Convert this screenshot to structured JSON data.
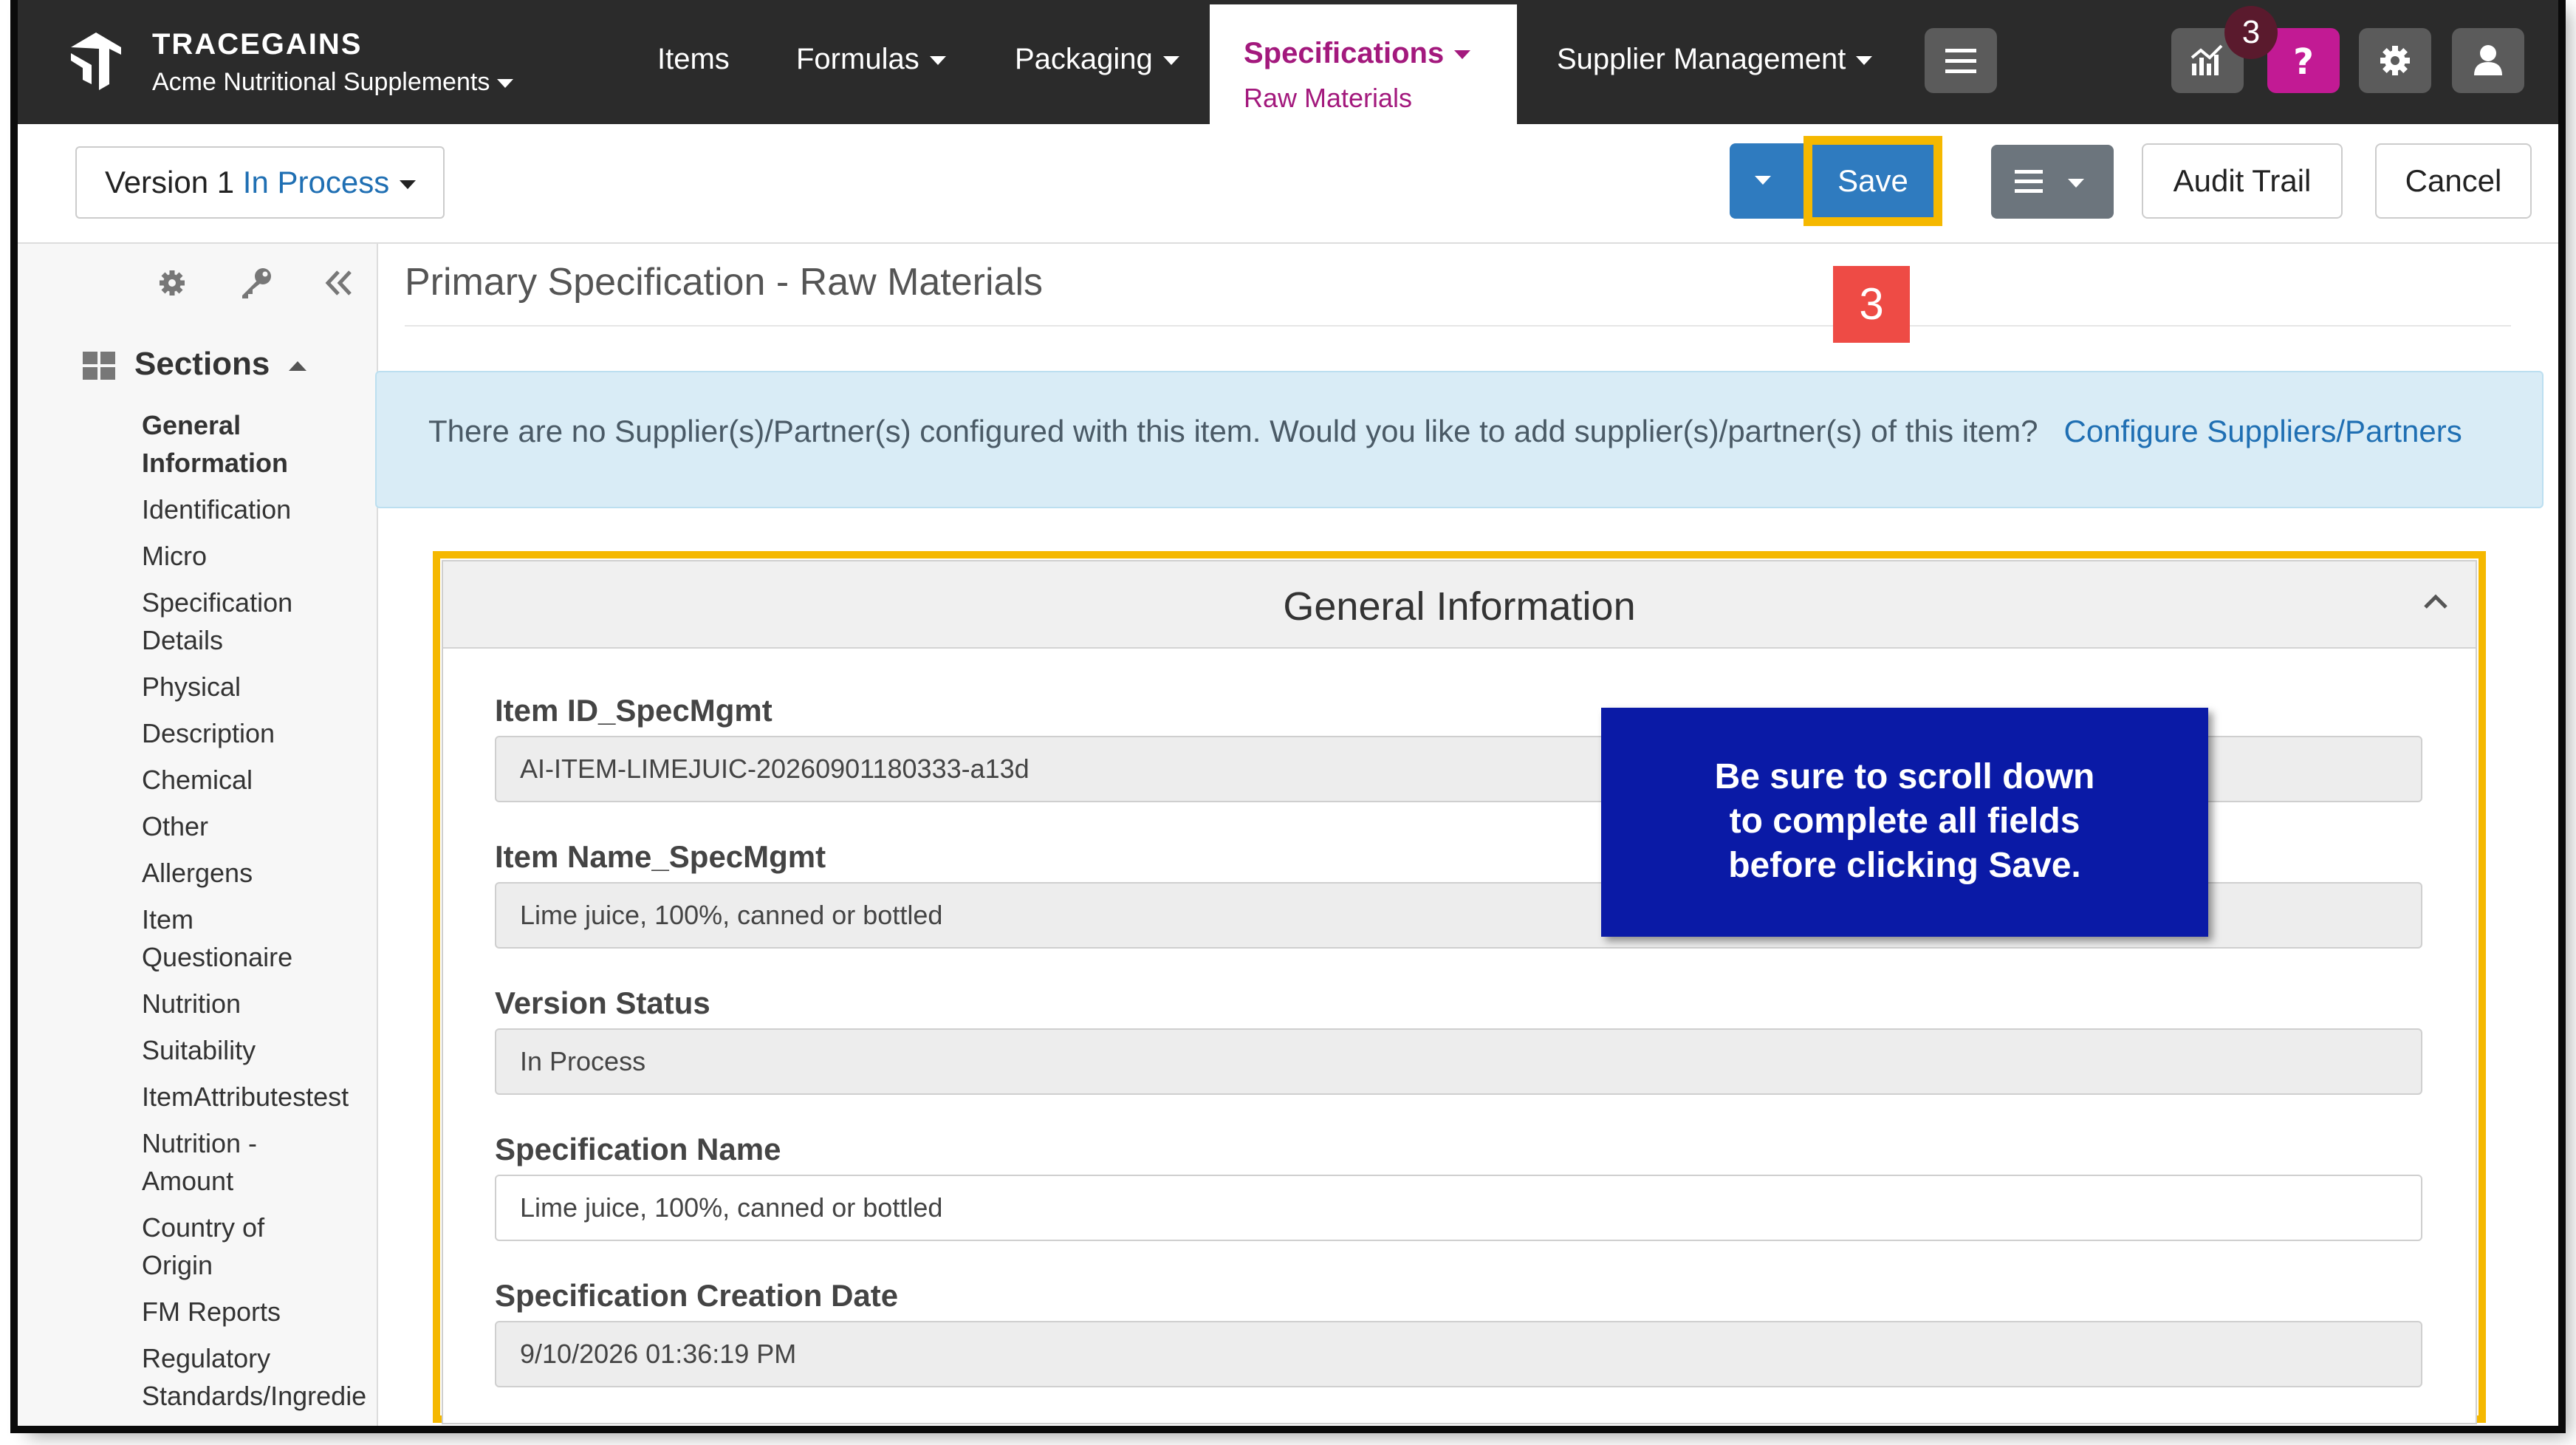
{
  "brand": {
    "name": "TRACEGAINS",
    "org": "Acme Nutritional Supplements"
  },
  "nav": {
    "items": "Items",
    "formulas": "Formulas",
    "packaging": "Packaging",
    "specifications": "Specifications",
    "specifications_sub": "Raw Materials",
    "supplier_management": "Supplier Management",
    "notification_count": "3",
    "icons": [
      "hamburger-icon",
      "analytics-icon",
      "help-icon",
      "gear-icon",
      "user-icon"
    ],
    "colors": {
      "bar": "#2b2b2b",
      "active_text": "#a3197d",
      "help": "#c21a94"
    }
  },
  "toolbar": {
    "version_label": "Version 1",
    "version_status": "In Process",
    "save_label": "Save",
    "audit_trail_label": "Audit Trail",
    "cancel_label": "Cancel",
    "colors": {
      "primary": "#2f7bbf",
      "highlight": "#f5b800"
    }
  },
  "sidebar": {
    "tools": [
      "gear-icon",
      "key-icon",
      "double-chevron-left-icon"
    ],
    "sections_title": "Sections",
    "items": [
      "General Information",
      "Identification",
      "Micro",
      "Specification Details",
      "Physical",
      "Description",
      "Chemical",
      "Other",
      "Allergens",
      "Item Questionaire",
      "Nutrition",
      "Suitability",
      "ItemAttributestest",
      "Nutrition - Amount",
      "Country of Origin",
      "FM Reports",
      "Regulatory Standards/Ingredie"
    ]
  },
  "main": {
    "page_title": "Primary Specification - Raw Materials",
    "step_badge": "3",
    "alert": {
      "text": "There are no Supplier(s)/Partner(s) configured with this item. Would you like to add supplier(s)/partner(s) of this item?",
      "link": "Configure Suppliers/Partners"
    },
    "panel": {
      "title": "General Information",
      "fields": [
        {
          "label": "Item ID_SpecMgmt",
          "value": "AI-ITEM-LIMEJUIC-20260901180333-a13d"
        },
        {
          "label": "Item Name_SpecMgmt",
          "value": "Lime juice, 100%, canned or bottled"
        },
        {
          "label": "Version Status",
          "value": "In Process"
        },
        {
          "label": "Specification Name",
          "value": "Lime juice, 100%, canned or bottled"
        },
        {
          "label": "Specification Creation Date",
          "value": "9/10/2026 01:36:19 PM"
        }
      ]
    },
    "callout": {
      "lines": [
        "Be sure to scroll down",
        "to complete all fields",
        "before clicking Save."
      ],
      "color": "#0a1aa6"
    }
  }
}
